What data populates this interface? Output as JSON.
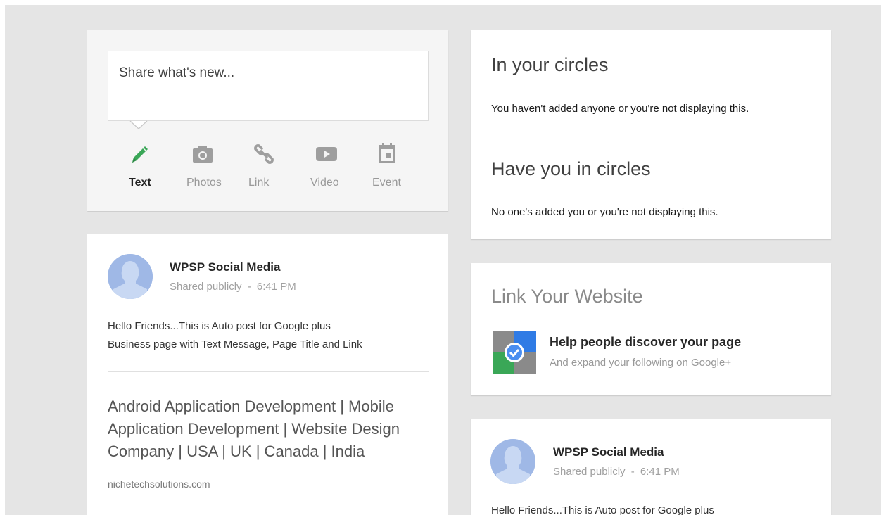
{
  "share": {
    "placeholder": "Share what's new...",
    "actions": [
      {
        "label": "Text",
        "icon": "pencil-icon"
      },
      {
        "label": "Photos",
        "icon": "camera-icon"
      },
      {
        "label": "Link",
        "icon": "link-icon"
      },
      {
        "label": "Video",
        "icon": "play-icon"
      },
      {
        "label": "Event",
        "icon": "calendar-icon"
      }
    ],
    "active_color": "#3aa757"
  },
  "post": {
    "author": "WPSP Social Media",
    "visibility": "Shared publicly",
    "separator": "-",
    "time": "6:41 PM",
    "text_line1": "Hello Friends...This is Auto post for Google plus",
    "text_line2": "Business page with Text Message, Page Title and Link",
    "link_title": "Android Application Development | Mobile Application Development | Website Design Company | USA | UK | Canada | India",
    "link_domain": "nichetechsolutions.com"
  },
  "circles": {
    "in_title": "In your circles",
    "in_text": "You haven't added anyone or you're not displaying this.",
    "have_title": "Have you in circles",
    "have_text": "No one's added you or you're not displaying this."
  },
  "link_site": {
    "title": "Link Your Website",
    "heading": "Help people discover your page",
    "subtitle": "And expand your following on Google+"
  },
  "post2": {
    "author": "WPSP Social Media",
    "visibility": "Shared publicly",
    "separator": "-",
    "time": "6:41 PM",
    "text_line1": "Hello Friends...This is Auto post for Google plus"
  }
}
